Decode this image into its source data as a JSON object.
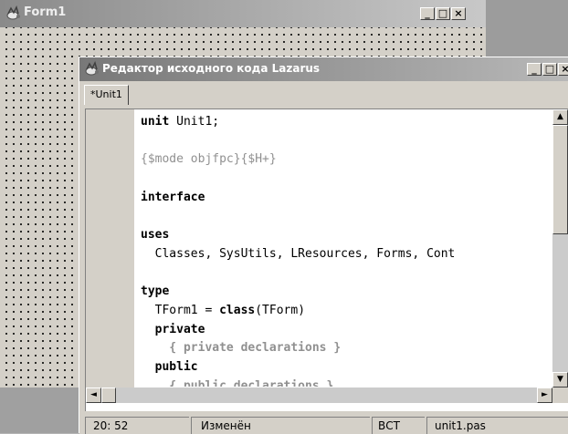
{
  "form1": {
    "title": "Form1",
    "caption_buttons": {
      "minimize": "_",
      "maximize": "□",
      "close": "×"
    }
  },
  "editor": {
    "title": "Редактор исходного кода Lazarus",
    "caption_buttons": {
      "minimize": "_",
      "maximize": "□",
      "close": "×"
    },
    "tabs": [
      {
        "label": "*Unit1"
      }
    ],
    "code_lines": [
      [
        {
          "t": "unit",
          "c": "kw"
        },
        {
          "t": " Unit1;",
          "c": ""
        }
      ],
      [
        {
          "t": "{$mode objfpc}{$H+}",
          "c": "dir"
        }
      ],
      [
        {
          "t": "interface",
          "c": "kw"
        }
      ],
      [
        {
          "t": "uses",
          "c": "kw"
        }
      ],
      [
        {
          "t": "  Classes, SysUtils, LResources, Forms, Cont",
          "c": ""
        }
      ],
      [
        {
          "t": "type",
          "c": "kw"
        }
      ],
      [
        {
          "t": "  TForm1 = ",
          "c": ""
        },
        {
          "t": "class",
          "c": "kw"
        },
        {
          "t": "(TForm)",
          "c": ""
        }
      ],
      [
        {
          "t": "  private",
          "c": "kw"
        }
      ],
      [
        {
          "t": "    { private declarations }",
          "c": "cm"
        }
      ],
      [
        {
          "t": "  public",
          "c": "kw"
        }
      ],
      [
        {
          "t": "    { public declarations }",
          "c": "cm"
        }
      ]
    ],
    "line_slots": [
      0,
      2,
      4,
      6,
      7,
      9,
      10,
      11,
      12,
      13,
      14
    ],
    "scroll": {
      "up": "▲",
      "down": "▼",
      "left": "◄",
      "right": "►"
    },
    "status": {
      "position": "20: 52",
      "modified": "Изменён",
      "mode": "ВСТ",
      "filename": "unit1.pas"
    }
  },
  "colors": {
    "window_face": "#d4d0c8",
    "titlebar_start": "#787878",
    "titlebar_end": "#b8b8b8",
    "comment_gray": "#909090"
  },
  "icons": {
    "form_icon": "app-form-icon",
    "editor_icon": "app-editor-icon"
  }
}
